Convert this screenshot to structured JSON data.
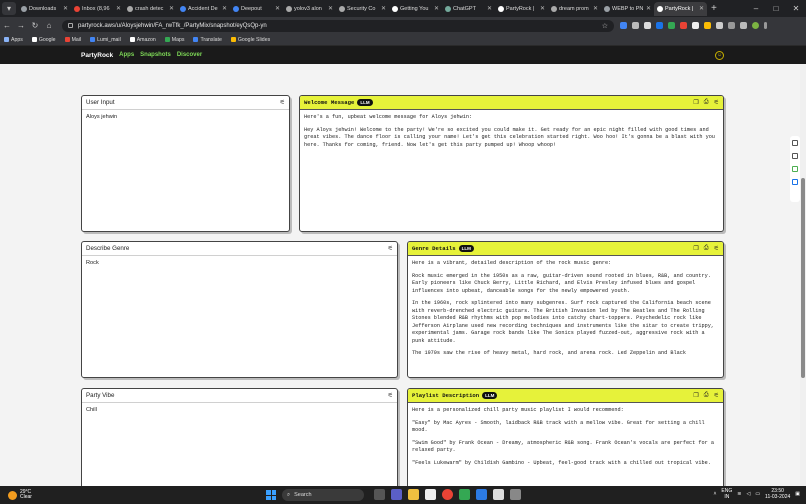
{
  "browser": {
    "tabs": [
      {
        "label": "Downloads",
        "color": "#9aa0a6"
      },
      {
        "label": "Inbox (8,96",
        "color": "#ea4335"
      },
      {
        "label": "crash detec",
        "color": "#aaaaaa"
      },
      {
        "label": "Accident De",
        "color": "#4285f4"
      },
      {
        "label": "Deepout",
        "color": "#4285f4"
      },
      {
        "label": "yolov3 alon",
        "color": "#aaaaaa"
      },
      {
        "label": "Security Co",
        "color": "#aaaaaa"
      },
      {
        "label": "Getting You",
        "color": "#ffffff"
      },
      {
        "label": "ChatGPT",
        "color": "#74aa9c"
      },
      {
        "label": "PartyRock |",
        "color": "#ffffff"
      },
      {
        "label": "dream prom",
        "color": "#aaaaaa"
      },
      {
        "label": "WEBP to PN",
        "color": "#9aa0a6"
      },
      {
        "label": "PartyRock |",
        "color": "#ffffff",
        "active": true
      }
    ],
    "url": "partyrock.aws/u/Aloysjehwin/FA_rwTfk_/PartyMix/snapshot/eyQsQp-yn",
    "bookmarks": [
      "Apps",
      "Google",
      "Mail",
      "Lumi_mail",
      "Amazon",
      "Maps",
      "Translate",
      "Google Slides"
    ],
    "bookmark_colors": [
      "#8ab4f8",
      "#ffffff",
      "#ea4335",
      "#4285f4",
      "#ffffff",
      "#34a853",
      "#4285f4",
      "#fbbc04"
    ]
  },
  "app": {
    "logo": "PartyRock",
    "nav": [
      "Apps",
      "Snapshots",
      "Discover"
    ]
  },
  "widgets": {
    "user_input": {
      "title": "User Input",
      "value": "Aloys jehwin"
    },
    "describe_genre": {
      "title": "Describe Genre",
      "value": "Rock"
    },
    "party_vibe": {
      "title": "Party Vibe",
      "value": "Chill"
    },
    "welcome": {
      "title": "Welcome Message",
      "badge": "LLM",
      "paragraphs": [
        "Here's a fun, upbeat welcome message for Aloys jehwin:",
        "Hey Aloys jehwin! Welcome to the party! We're so excited you could make it. Get ready for an epic night filled with good times and great vibes. The dance floor is calling your name! Let's get this celebration started right. Woo hoo! It's gonna be a blast with you here. Thanks for coming, friend. Now let's get this party pumped up! Whoop whoop!"
      ]
    },
    "genre_details": {
      "title": "Genre Details",
      "badge": "LLM",
      "paragraphs": [
        "Here is a vibrant, detailed description of the rock music genre:",
        "Rock music emerged in the 1950s as a raw, guitar-driven sound rooted in blues, R&B, and country. Early pioneers like Chuck Berry, Little Richard, and Elvis Presley infused blues and gospel influences into upbeat, danceable songs for the newly empowered youth.",
        "In the 1960s, rock splintered into many subgenres. Surf rock captured the California beach scene with reverb-drenched electric guitars. The British Invasion led by The Beatles and The Rolling Stones blended R&B rhythms with pop melodies into catchy chart-toppers. Psychedelic rock like Jefferson Airplane used new recording techniques and instruments like the sitar to create trippy, experimental jams. Garage rock bands like The Sonics played fuzzed-out, aggressive rock with a punk attitude.",
        "The 1970s saw the rise of heavy metal, hard rock, and arena rock. Led Zeppelin and Black"
      ]
    },
    "playlist": {
      "title": "Playlist Description",
      "badge": "LLM",
      "paragraphs": [
        "Here is a personalized chill party music playlist I would recommend:",
        "\"Easy\" by Mac Ayres - Smooth, laidback R&B track with a mellow vibe. Great for setting a chill mood.",
        "\"Swim Good\" by Frank Ocean - Dreamy, atmospheric R&B song. Frank Ocean's vocals are perfect for a relaxed party.",
        "\"Feels Lukewarm\" by Childish Gambino - Upbeat, feel-good track with a chilled out tropical vibe."
      ]
    }
  },
  "taskbar": {
    "weather_temp": "29°C",
    "weather_text": "Clear",
    "search": "Search",
    "lang": "ENG",
    "region": "IN",
    "time": "23:50",
    "date": "11-03-2024"
  }
}
